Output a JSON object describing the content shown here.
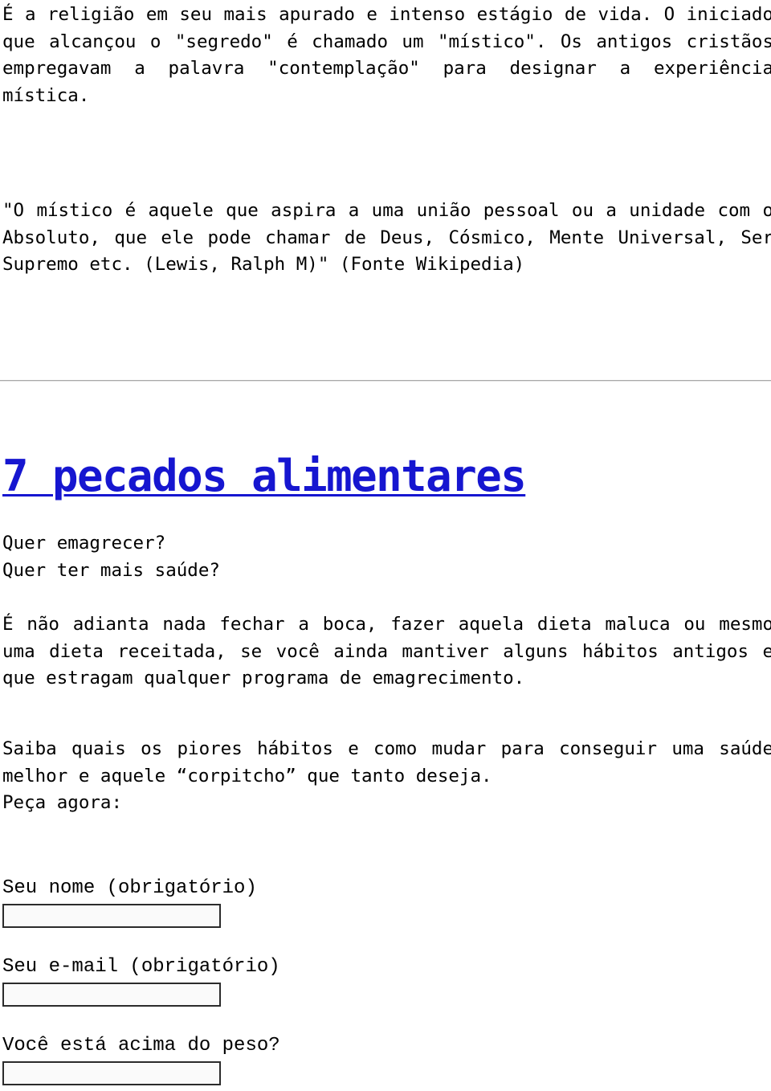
{
  "article": {
    "intro_paragraph": "É a religião em seu mais apurado e intenso estágio de vida. O iniciado que alcançou o \"segredo\" é chamado um \"místico\". Os antigos cristãos empregavam a palavra \"contemplação\" para designar a experiência mística.",
    "quote_paragraph": "\"O místico é aquele que aspira a uma união pessoal ou a unidade com o Absoluto, que ele pode chamar de Deus, Cósmico, Mente Universal, Ser Supremo etc. (Lewis, Ralph M)\" (Fonte Wikipedia)"
  },
  "promo": {
    "headline": "7 pecados alimentares",
    "headline_color": "#1616d0",
    "hook": "Quer emagrecer?\nQuer ter mais saúde?",
    "body": "É não adianta nada fechar a boca, fazer aquela dieta maluca ou mesmo uma dieta receitada, se você ainda mantiver alguns hábitos antigos e que estragam qualquer programa de emagrecimento.",
    "closing": "Saiba quais os piores hábitos e como mudar para conseguir uma saúde melhor e aquele “corpitcho” que tanto deseja.\nPeça agora:"
  },
  "form": {
    "fields": [
      {
        "label": "Seu nome (obrigatório)",
        "value": "",
        "placeholder": ""
      },
      {
        "label": "Seu e-mail (obrigatório)",
        "value": "",
        "placeholder": ""
      },
      {
        "label": "Você está acima do peso?",
        "value": "",
        "placeholder": ""
      }
    ]
  }
}
